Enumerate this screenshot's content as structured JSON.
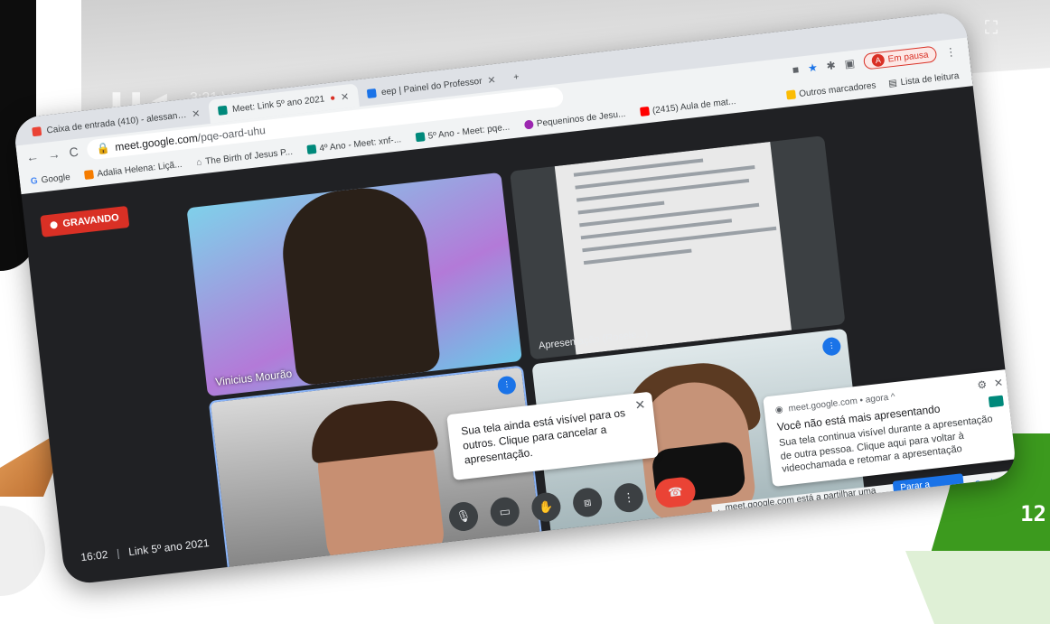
{
  "browser": {
    "tabs": [
      {
        "label": "Caixa de entrada (410) - alessan…",
        "favicon": "gmail-icon",
        "active": false
      },
      {
        "label": "Meet: Link 5º ano 2021",
        "favicon": "meet-icon",
        "active": true
      },
      {
        "label": "eep | Painel do Professor",
        "favicon": "classroom-icon",
        "active": false
      }
    ],
    "new_tab": "+",
    "url_host": "meet.google.com",
    "url_path": "/pqe-oard-uhu",
    "profile_initial": "A",
    "profile_status": "Em pausa",
    "bookmarks": [
      {
        "label": "Google",
        "icon": "google-icon"
      },
      {
        "label": "Adalia Helena: Liçã...",
        "icon": "blogger-icon"
      },
      {
        "label": "The Birth of Jesus P...",
        "icon": "house-icon"
      },
      {
        "label": "4º Ano - Meet: xnf-...",
        "icon": "meet-icon"
      },
      {
        "label": "5º Ano - Meet: pqe...",
        "icon": "meet-icon"
      },
      {
        "label": "Pequeninos de Jesu...",
        "icon": "site-icon"
      },
      {
        "label": "(2415) Aula de mat...",
        "icon": "youtube-icon"
      }
    ],
    "bookmarks_right": [
      "Outros marcadores",
      "Lista de leitura"
    ]
  },
  "video_time": "3:21 \\ 10:43",
  "meet": {
    "recording_label": "GRAVANDO",
    "participants": [
      {
        "name": "Vinicius Mourão"
      },
      {
        "name": "Apresentação (Rosele...)"
      },
      {
        "name": "gabriel freitas"
      },
      {
        "name": ""
      }
    ],
    "meeting_time": "16:02",
    "meeting_name": "Link 5º ano 2021",
    "popup_text": "Sua tela ainda está visível para os outros. Clique para cancelar a apresentação.",
    "notification": {
      "source": "meet.google.com • agora ^",
      "title": "Você não está mais apresentando",
      "body": "Sua tela continua visível durante a apresentação de outra pessoa. Clique aqui para voltar à videochamada e retomar a apresentação"
    },
    "share_bar": {
      "text": "meet.google.com está a partilhar uma janela.",
      "stop": "Parar a partilha",
      "hide": "Ocultar"
    }
  },
  "slide_number": "12"
}
